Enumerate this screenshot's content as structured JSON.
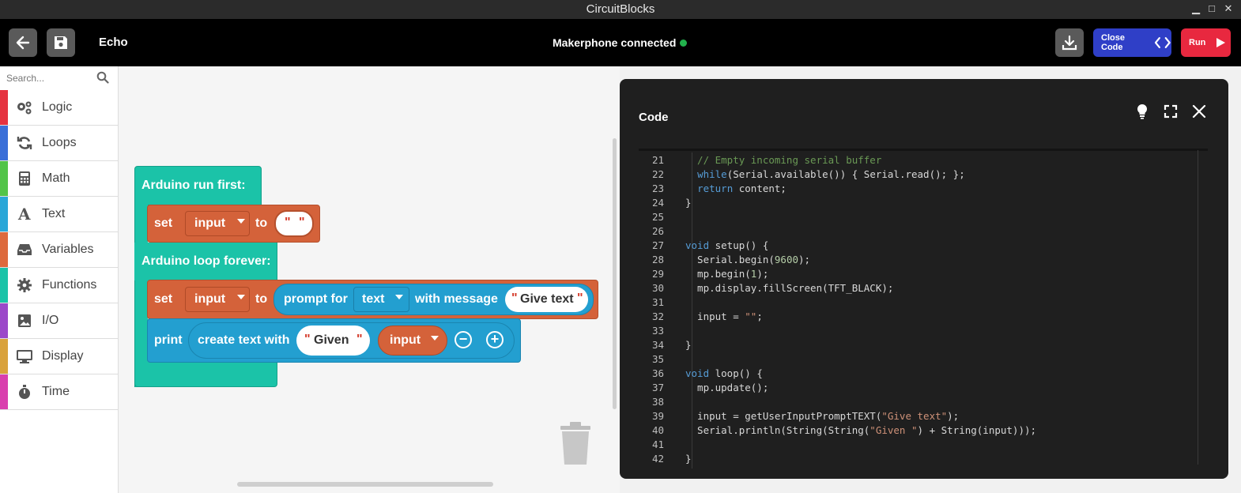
{
  "window": {
    "title": "CircuitBlocks"
  },
  "toolbar": {
    "project_name": "Echo",
    "connection_status": "Makerphone connected",
    "close_code_label": "Close Code",
    "run_label": "Run"
  },
  "sidebar": {
    "search_placeholder": "Search...",
    "categories": [
      {
        "label": "Logic",
        "color": "#e53340",
        "icon": "gears-icon"
      },
      {
        "label": "Loops",
        "color": "#3a6fd8",
        "icon": "loop-arrows-icon"
      },
      {
        "label": "Math",
        "color": "#52c449",
        "icon": "calculator-icon"
      },
      {
        "label": "Text",
        "color": "#2aa7d8",
        "icon": "text-a-icon"
      },
      {
        "label": "Variables",
        "color": "#dd6a3d",
        "icon": "inbox-icon"
      },
      {
        "label": "Functions",
        "color": "#1bc3a8",
        "icon": "gear-icon"
      },
      {
        "label": "I/O",
        "color": "#9b48c9",
        "icon": "image-icon"
      },
      {
        "label": "Display",
        "color": "#d9a23c",
        "icon": "monitor-icon"
      },
      {
        "label": "Time",
        "color": "#d93fae",
        "icon": "stopwatch-icon"
      }
    ]
  },
  "blocks": {
    "run_first_label": "Arduino run first:",
    "loop_forever_label": "Arduino loop forever:",
    "set_label": "set",
    "to_label": "to",
    "var_input": "input",
    "prompt_for_label": "prompt for",
    "prompt_type": "text",
    "with_message_label": "with message",
    "message_text": "Give text",
    "print_label": "print",
    "create_text_label": "create text with",
    "given_text": "Given",
    "empty_string": " "
  },
  "code_panel": {
    "title": "Code",
    "lines": [
      {
        "n": "21",
        "t": "  // Empty incoming serial buffer"
      },
      {
        "n": "22",
        "t": "  while(Serial.available()) { Serial.read(); };"
      },
      {
        "n": "23",
        "t": "  return content;"
      },
      {
        "n": "24",
        "t": "}"
      },
      {
        "n": "25",
        "t": ""
      },
      {
        "n": "26",
        "t": ""
      },
      {
        "n": "27",
        "t": "void setup() {"
      },
      {
        "n": "28",
        "t": "  Serial.begin(9600);"
      },
      {
        "n": "29",
        "t": "  mp.begin(1);"
      },
      {
        "n": "30",
        "t": "  mp.display.fillScreen(TFT_BLACK);"
      },
      {
        "n": "31",
        "t": ""
      },
      {
        "n": "32",
        "t": "  input = \"\";"
      },
      {
        "n": "33",
        "t": ""
      },
      {
        "n": "34",
        "t": "}"
      },
      {
        "n": "35",
        "t": ""
      },
      {
        "n": "36",
        "t": "void loop() {"
      },
      {
        "n": "37",
        "t": "  mp.update();"
      },
      {
        "n": "38",
        "t": ""
      },
      {
        "n": "39",
        "t": "  input = getUserInputPromptTEXT(\"Give text\");"
      },
      {
        "n": "40",
        "t": "  Serial.println(String(String(\"Given \") + String(input)));"
      },
      {
        "n": "41",
        "t": ""
      },
      {
        "n": "42",
        "t": "}"
      }
    ]
  }
}
